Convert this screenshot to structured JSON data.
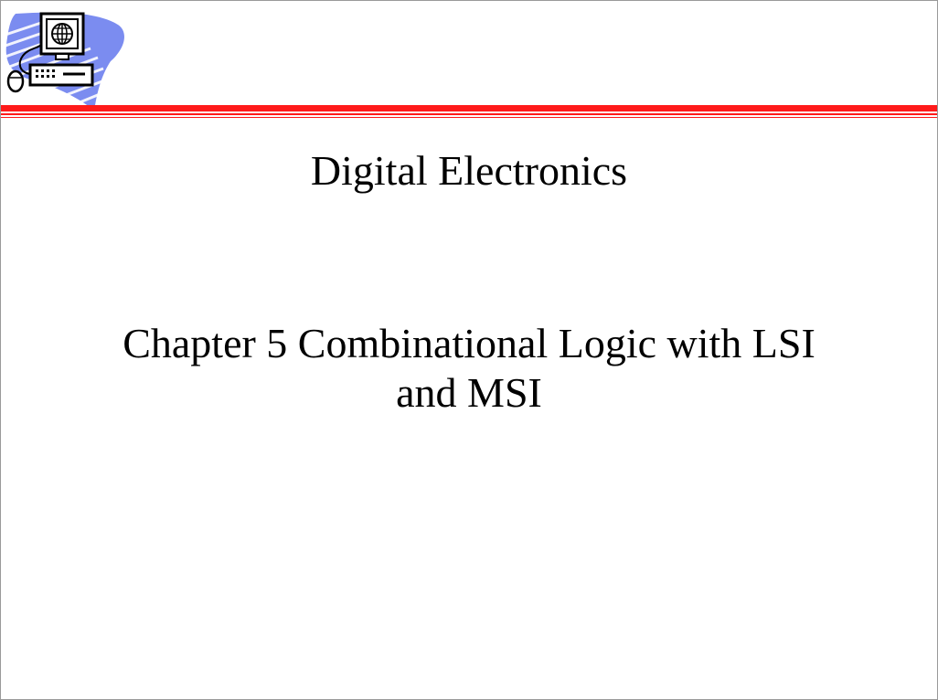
{
  "slide": {
    "title": "Digital Electronics",
    "subtitle_line1": "Chapter 5 Combinational Logic with LSI",
    "subtitle_line2": "and MSI"
  },
  "logo": {
    "icon": "computer-globe-icon"
  },
  "colors": {
    "rule_red": "#ff1a1a",
    "logo_blue": "#7b8cf0",
    "text": "#000000",
    "border": "#9a9a9a"
  }
}
